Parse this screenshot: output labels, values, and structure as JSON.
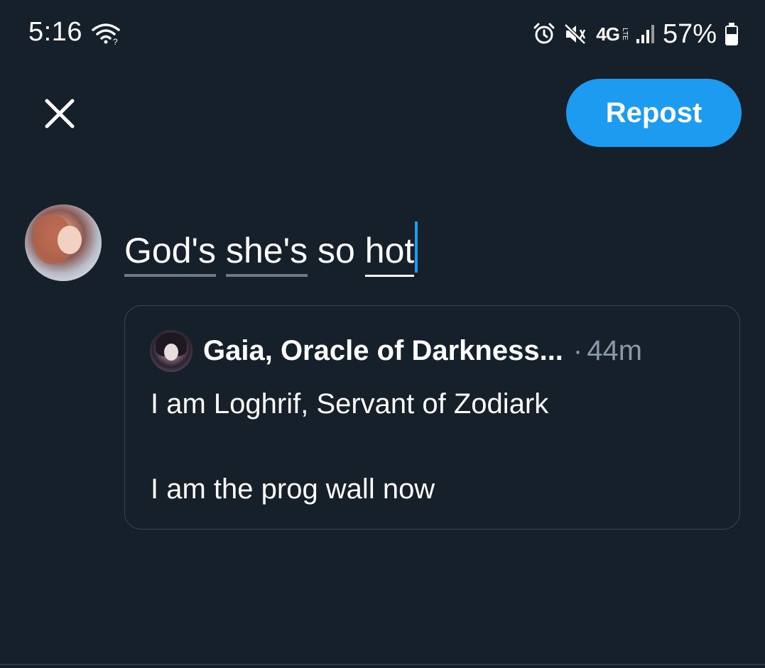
{
  "status_bar": {
    "time": "5:16",
    "network": "4G",
    "network_sub": "LTE",
    "battery": "57%",
    "icons": [
      "wifi-icon",
      "alarm-icon",
      "mute-icon",
      "signal-icon",
      "battery-icon"
    ]
  },
  "header": {
    "close_icon": "close-icon",
    "repost_label": "Repost",
    "accent_color": "#1d9bf0"
  },
  "compose": {
    "words": [
      "God's",
      "she's",
      "so",
      "hot"
    ]
  },
  "quote": {
    "author": "Gaia, Oracle of Darkness...",
    "separator": "·",
    "time": "44m",
    "lines": [
      "I am Loghrif, Servant of Zodiark",
      "I am the prog wall now"
    ]
  },
  "colors": {
    "background": "#15202b",
    "border": "#38444d",
    "muted_text": "#8b98a5"
  }
}
